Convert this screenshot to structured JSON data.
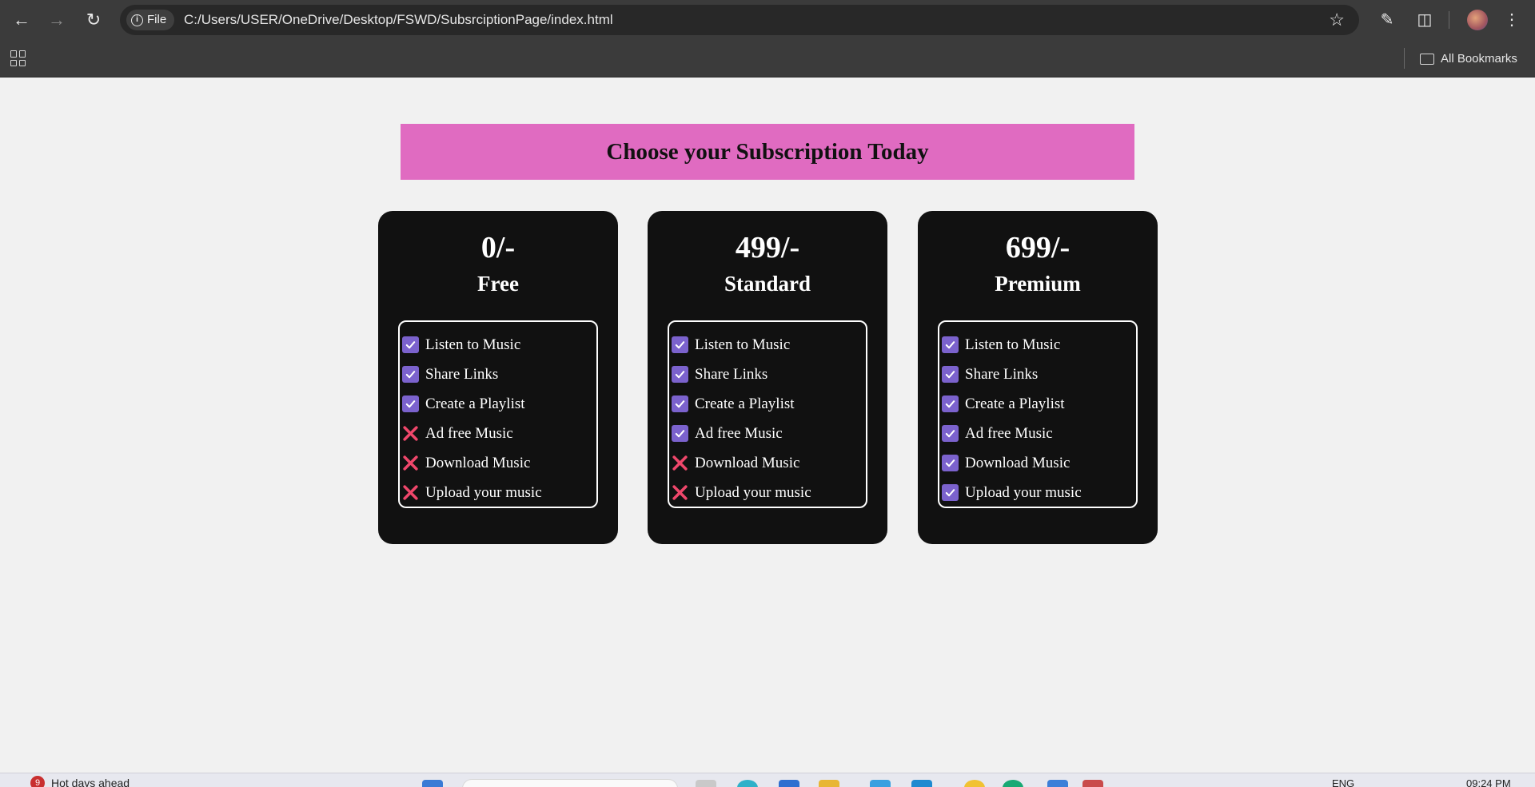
{
  "browser": {
    "url_scheme_label": "File",
    "url": "C:/Users/USER/OneDrive/Desktop/FSWD/SubsrciptionPage/index.html",
    "bookmarks_label": "All Bookmarks"
  },
  "page": {
    "title": "Choose your Subscription Today",
    "accent_color": "#e06bc1",
    "card_color": "#111111",
    "check_color": "#7b62cd",
    "cross_color": "#f0476b"
  },
  "plans": [
    {
      "price": "0/-",
      "name": "Free",
      "features": [
        {
          "label": "Listen to Music",
          "included": true
        },
        {
          "label": "Share Links",
          "included": true
        },
        {
          "label": "Create a Playlist",
          "included": true
        },
        {
          "label": "Ad free Music",
          "included": false
        },
        {
          "label": "Download Music",
          "included": false
        },
        {
          "label": "Upload your music",
          "included": false
        }
      ]
    },
    {
      "price": "499/-",
      "name": "Standard",
      "features": [
        {
          "label": "Listen to Music",
          "included": true
        },
        {
          "label": "Share Links",
          "included": true
        },
        {
          "label": "Create a Playlist",
          "included": true
        },
        {
          "label": "Ad free Music",
          "included": true
        },
        {
          "label": "Download Music",
          "included": false
        },
        {
          "label": "Upload your music",
          "included": false
        }
      ]
    },
    {
      "price": "699/-",
      "name": "Premium",
      "features": [
        {
          "label": "Listen to Music",
          "included": true
        },
        {
          "label": "Share Links",
          "included": true
        },
        {
          "label": "Create a Playlist",
          "included": true
        },
        {
          "label": "Ad free Music",
          "included": true
        },
        {
          "label": "Download Music",
          "included": true
        },
        {
          "label": "Upload your music",
          "included": true
        }
      ]
    }
  ],
  "taskbar": {
    "weather_badge": "9",
    "weather_text": "Hot days ahead",
    "language": "ENG",
    "time": "09:24 PM"
  }
}
